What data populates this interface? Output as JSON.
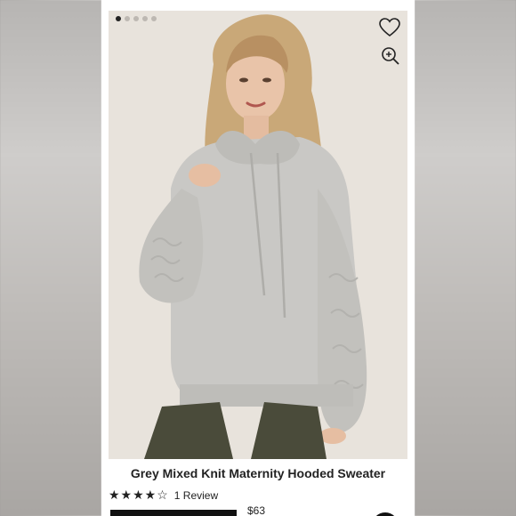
{
  "product": {
    "title": "Grey Mixed Knit Maternity Hooded Sweater",
    "rating_stars": 4,
    "rating_max": 5,
    "review_count_label": "1 Review",
    "price": "$63"
  },
  "gallery": {
    "image_count": 5,
    "active_index": 0
  },
  "colors": {
    "background": "#f4f3f2",
    "sweater_grey": "#c9c8c5",
    "pants_olive": "#4a4b3a",
    "accent_dark": "#222222"
  },
  "icons": {
    "favorite": "heart-icon",
    "zoom": "zoom-in-icon"
  }
}
